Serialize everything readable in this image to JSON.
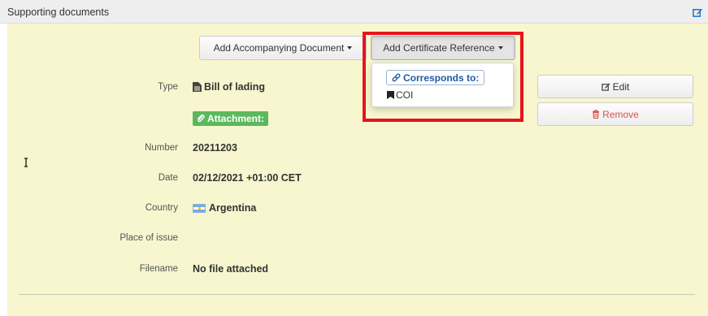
{
  "header": {
    "title": "Supporting documents",
    "edit_icon": "edit-icon"
  },
  "toolbar": {
    "add_accompanying_label": "Add Accompanying Document",
    "add_certificate_label": "Add Certificate Reference"
  },
  "dropdown": {
    "corresponds_label": "Corresponds to:",
    "corresponds_icon": "link-icon",
    "items": [
      {
        "label": "COI",
        "icon": "bookmark-icon"
      }
    ]
  },
  "document": {
    "type_label": "Type",
    "type_value": "Bill of lading",
    "type_icon": "file-icon",
    "attachment_label": "Attachment:",
    "attachment_icon": "paperclip-icon",
    "number_label": "Number",
    "number_value": "20211203",
    "date_label": "Date",
    "date_value": "02/12/2021 +01:00 CET",
    "country_label": "Country",
    "country_value": "Argentina",
    "country_flag": "argentina-flag",
    "place_label": "Place of issue",
    "place_value": "",
    "filename_label": "Filename",
    "filename_value": "No file attached"
  },
  "actions": {
    "edit_label": "Edit",
    "remove_label": "Remove"
  },
  "colors": {
    "panel_background": "#f7f6cf",
    "highlight": "#e5151c",
    "attachment_badge": "#5cb85c",
    "remove_text": "#d9534f",
    "link_blue": "#1d5aa8"
  }
}
